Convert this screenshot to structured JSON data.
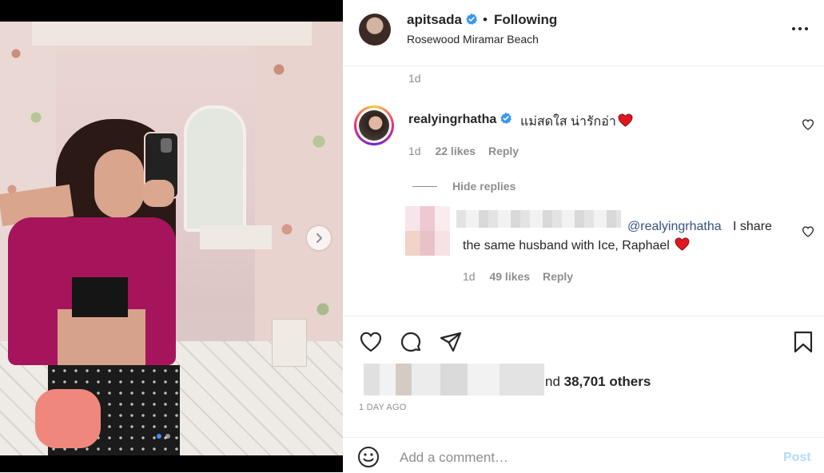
{
  "post": {
    "username": "apitsada",
    "separator": "•",
    "follow_status": "Following",
    "location": "Rosewood Miramar Beach",
    "more_icon": "more-horizontal-icon"
  },
  "comments": {
    "caption_time": "1d",
    "items": [
      {
        "username": "realyingrhatha",
        "text": "แม่สดใส น่ารักอ่า",
        "emoji": "red-heart",
        "time": "1d",
        "likes": "22 likes",
        "reply_label": "Reply"
      }
    ],
    "hide_replies_label": "Hide replies",
    "reply": {
      "mention": "@realyingrhatha",
      "text_line1": "I share",
      "text_line2": "the same husband with Ice, Raphael",
      "emoji": "red-heart",
      "time": "1d",
      "likes": "49 likes",
      "reply_label": "Reply"
    }
  },
  "actions": {
    "like_icon": "heart-outline-icon",
    "comment_icon": "comment-bubble-icon",
    "share_icon": "paper-plane-icon",
    "save_icon": "bookmark-icon",
    "likes_suffix": "nd ",
    "likes_count": "38,701 others",
    "posted_ago": "1 DAY AGO"
  },
  "comment_bar": {
    "placeholder": "Add a comment…",
    "post_label": "Post",
    "emoji_icon": "smiley-icon"
  },
  "carousel": {
    "dots": 2,
    "active_dot": 0
  },
  "colors": {
    "verified_blue": "#3897f0",
    "link_blue": "#385185",
    "post_button_disabled": "#b3dbff",
    "heart_red": "#ed4956",
    "active_dot": "#3f8cf0"
  }
}
